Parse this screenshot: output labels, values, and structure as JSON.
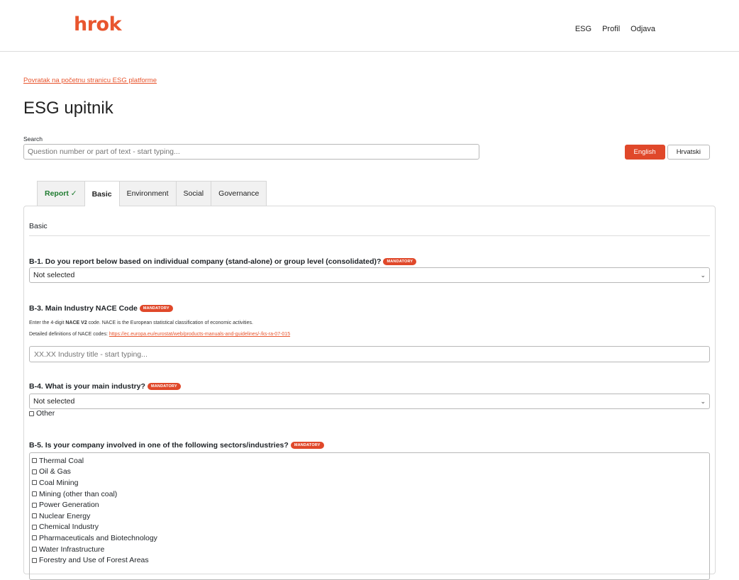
{
  "header": {
    "logo": "hrok",
    "nav": [
      "ESG",
      "Profil",
      "Odjava"
    ]
  },
  "back_link": "Povratak na početnu stranicu ESG platforme",
  "page_title": "ESG upitnik",
  "search": {
    "label": "Search",
    "placeholder": "Question number or part of text - start typing..."
  },
  "languages": {
    "active": "English",
    "other": "Hrvatski"
  },
  "tabs": [
    {
      "label": "Report ✓",
      "state": "done"
    },
    {
      "label": "Basic",
      "state": "active"
    },
    {
      "label": "Environment",
      "state": ""
    },
    {
      "label": "Social",
      "state": ""
    },
    {
      "label": "Governance",
      "state": ""
    }
  ],
  "section": {
    "title": "Basic"
  },
  "badge_text": "MANDATORY",
  "questions": {
    "b1": {
      "title": "B-1. Do you report below based on individual company (stand-alone) or group level (consolidated)?",
      "selected": "Not selected"
    },
    "b3": {
      "title": "B-3. Main Industry NACE Code",
      "help1_pre": "Enter the 4-digit ",
      "help1_bold": "NACE V2",
      "help1_post": " code. NACE is the European statistical classification of economic activities.",
      "help2_pre": "Detailed definitions of NACE codes: ",
      "help2_link": "https://ec.europa.eu/eurostat/web/products-manuals-and-guidelines/-/ks-ra-07-015",
      "placeholder": "XX.XX Industry title - start typing..."
    },
    "b4": {
      "title": "B-4. What is your main industry?",
      "selected": "Not selected",
      "other_label": "Other"
    },
    "b5": {
      "title": "B-5. Is your company involved in one of the following sectors/industries?",
      "options": [
        "Thermal Coal",
        "Oil & Gas",
        "Coal Mining",
        "Mining (other than coal)",
        "Power Generation",
        "Nuclear Energy",
        "Chemical Industry",
        "Pharmaceuticals and Biotechnology",
        "Water Infrastructure",
        "Forestry and Use of Forest Areas"
      ]
    }
  },
  "colors": {
    "accent": "#e0482a",
    "done": "#1e7b2f"
  }
}
